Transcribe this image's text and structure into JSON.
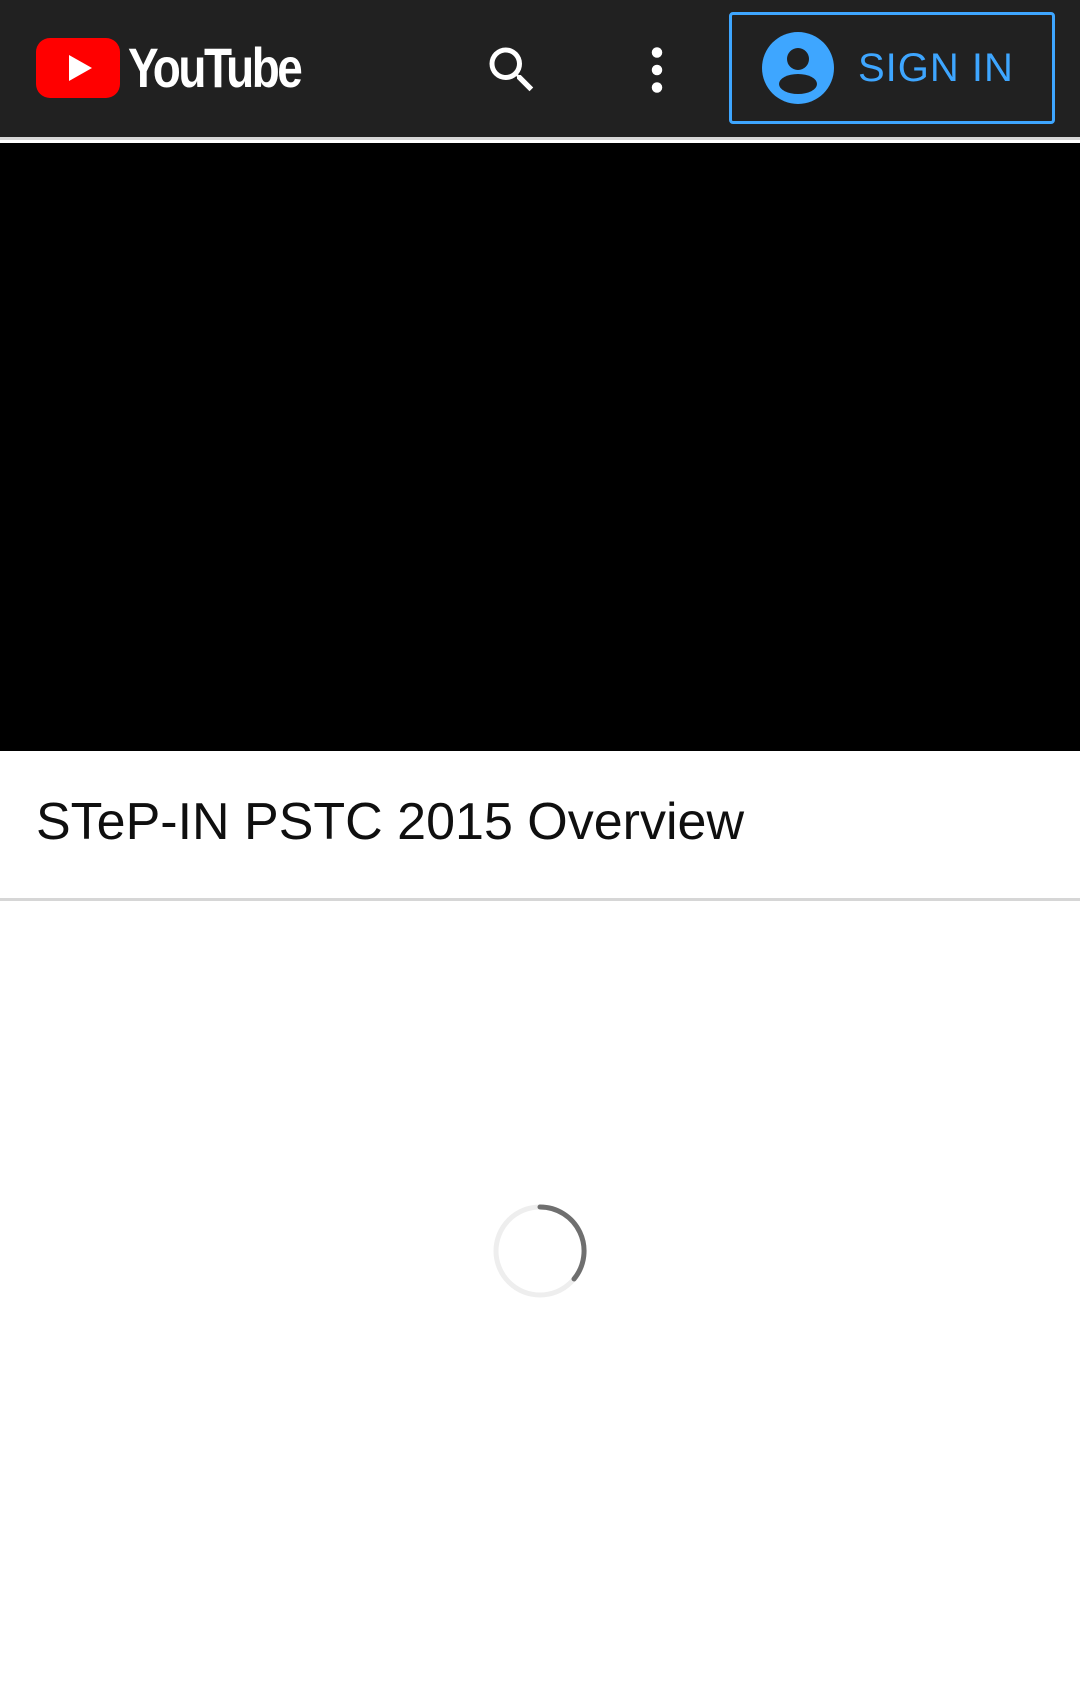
{
  "header": {
    "logo_text": "YouTube",
    "search_icon": "search-icon",
    "more_icon": "more-vert-icon",
    "sign_in": {
      "label": "SIGN IN",
      "icon": "account-circle-icon"
    }
  },
  "video": {
    "title": "STeP-IN PSTC 2015 Overview"
  },
  "status": {
    "loading_icon": "loading-spinner-icon"
  },
  "colors": {
    "appbar": "#212121",
    "brand_red": "#ff0000",
    "accent_blue": "#3ea6ff",
    "player_bg": "#000000"
  }
}
